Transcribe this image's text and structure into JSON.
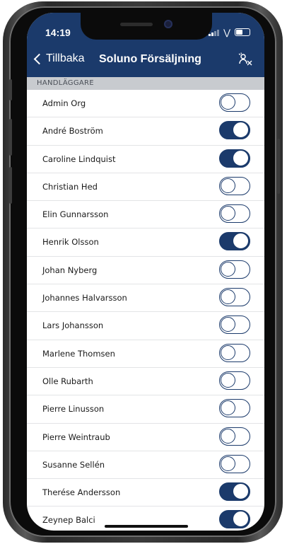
{
  "status_bar": {
    "time": "14:19"
  },
  "nav": {
    "back_label": "Tillbaka",
    "title": "Soluno Försäljning",
    "action_icon": "user-filter-icon"
  },
  "section": {
    "header": "HANDLÄGGARE"
  },
  "colors": {
    "brand": "#1b3a6b",
    "section_bg": "#c8cbcf",
    "divider": "#e3e4e6",
    "toggle_on": "#1b3a6b"
  },
  "handlers": [
    {
      "name": "Admin Org",
      "enabled": false
    },
    {
      "name": "André Boström",
      "enabled": true
    },
    {
      "name": "Caroline Lindquist",
      "enabled": true
    },
    {
      "name": "Christian Hed",
      "enabled": false
    },
    {
      "name": "Elin Gunnarsson",
      "enabled": false
    },
    {
      "name": "Henrik Olsson",
      "enabled": true
    },
    {
      "name": "Johan Nyberg",
      "enabled": false
    },
    {
      "name": "Johannes Halvarsson",
      "enabled": false
    },
    {
      "name": "Lars Johansson",
      "enabled": false
    },
    {
      "name": "Marlene Thomsen",
      "enabled": false
    },
    {
      "name": "Olle Rubarth",
      "enabled": false
    },
    {
      "name": "Pierre Linusson",
      "enabled": false
    },
    {
      "name": "Pierre Weintraub",
      "enabled": false
    },
    {
      "name": "Susanne Sellén",
      "enabled": false
    },
    {
      "name": "Therése Andersson",
      "enabled": true
    },
    {
      "name": "Zeynep Balci",
      "enabled": true
    }
  ]
}
